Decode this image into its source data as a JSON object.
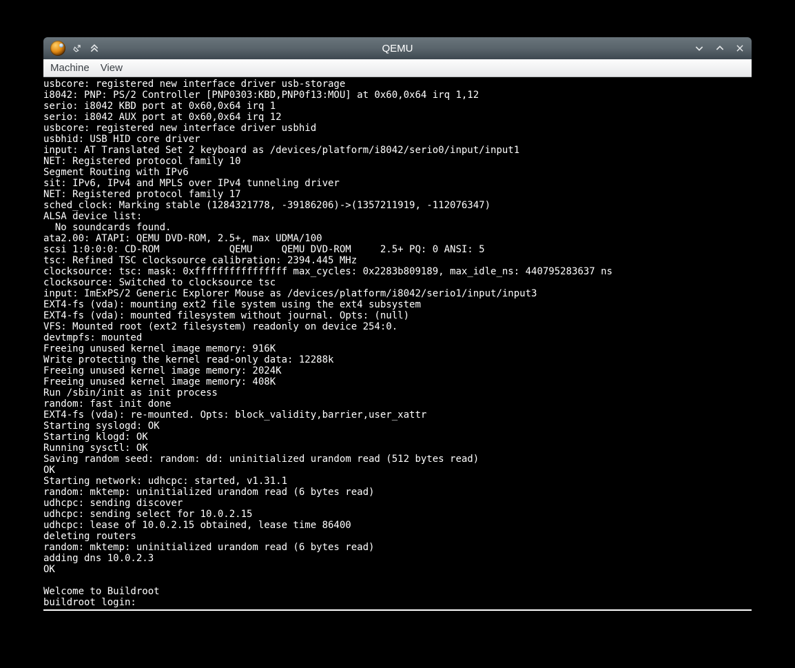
{
  "titlebar": {
    "title": "QEMU"
  },
  "menubar": {
    "machine": "Machine",
    "view": "View"
  },
  "terminal": {
    "lines": [
      "usbcore: registered new interface driver usb-storage",
      "i8042: PNP: PS/2 Controller [PNP0303:KBD,PNP0f13:MOU] at 0x60,0x64 irq 1,12",
      "serio: i8042 KBD port at 0x60,0x64 irq 1",
      "serio: i8042 AUX port at 0x60,0x64 irq 12",
      "usbcore: registered new interface driver usbhid",
      "usbhid: USB HID core driver",
      "input: AT Translated Set 2 keyboard as /devices/platform/i8042/serio0/input/input1",
      "NET: Registered protocol family 10",
      "Segment Routing with IPv6",
      "sit: IPv6, IPv4 and MPLS over IPv4 tunneling driver",
      "NET: Registered protocol family 17",
      "sched_clock: Marking stable (1284321778, -39186206)->(1357211919, -112076347)",
      "ALSA device list:",
      "  No soundcards found.",
      "ata2.00: ATAPI: QEMU DVD-ROM, 2.5+, max UDMA/100",
      "scsi 1:0:0:0: CD-ROM            QEMU     QEMU DVD-ROM     2.5+ PQ: 0 ANSI: 5",
      "tsc: Refined TSC clocksource calibration: 2394.445 MHz",
      "clocksource: tsc: mask: 0xffffffffffffffff max_cycles: 0x2283b809189, max_idle_ns: 440795283637 ns",
      "clocksource: Switched to clocksource tsc",
      "input: ImExPS/2 Generic Explorer Mouse as /devices/platform/i8042/serio1/input/input3",
      "EXT4-fs (vda): mounting ext2 file system using the ext4 subsystem",
      "EXT4-fs (vda): mounted filesystem without journal. Opts: (null)",
      "VFS: Mounted root (ext2 filesystem) readonly on device 254:0.",
      "devtmpfs: mounted",
      "Freeing unused kernel image memory: 916K",
      "Write protecting the kernel read-only data: 12288k",
      "Freeing unused kernel image memory: 2024K",
      "Freeing unused kernel image memory: 408K",
      "Run /sbin/init as init process",
      "random: fast init done",
      "EXT4-fs (vda): re-mounted. Opts: block_validity,barrier,user_xattr",
      "Starting syslogd: OK",
      "Starting klogd: OK",
      "Running sysctl: OK",
      "Saving random seed: random: dd: uninitialized urandom read (512 bytes read)",
      "OK",
      "Starting network: udhcpc: started, v1.31.1",
      "random: mktemp: uninitialized urandom read (6 bytes read)",
      "udhcpc: sending discover",
      "udhcpc: sending select for 10.0.2.15",
      "udhcpc: lease of 10.0.2.15 obtained, lease time 86400",
      "deleting routers",
      "random: mktemp: uninitialized urandom read (6 bytes read)",
      "adding dns 10.0.2.3",
      "OK",
      "",
      "Welcome to Buildroot",
      "buildroot login: "
    ]
  }
}
